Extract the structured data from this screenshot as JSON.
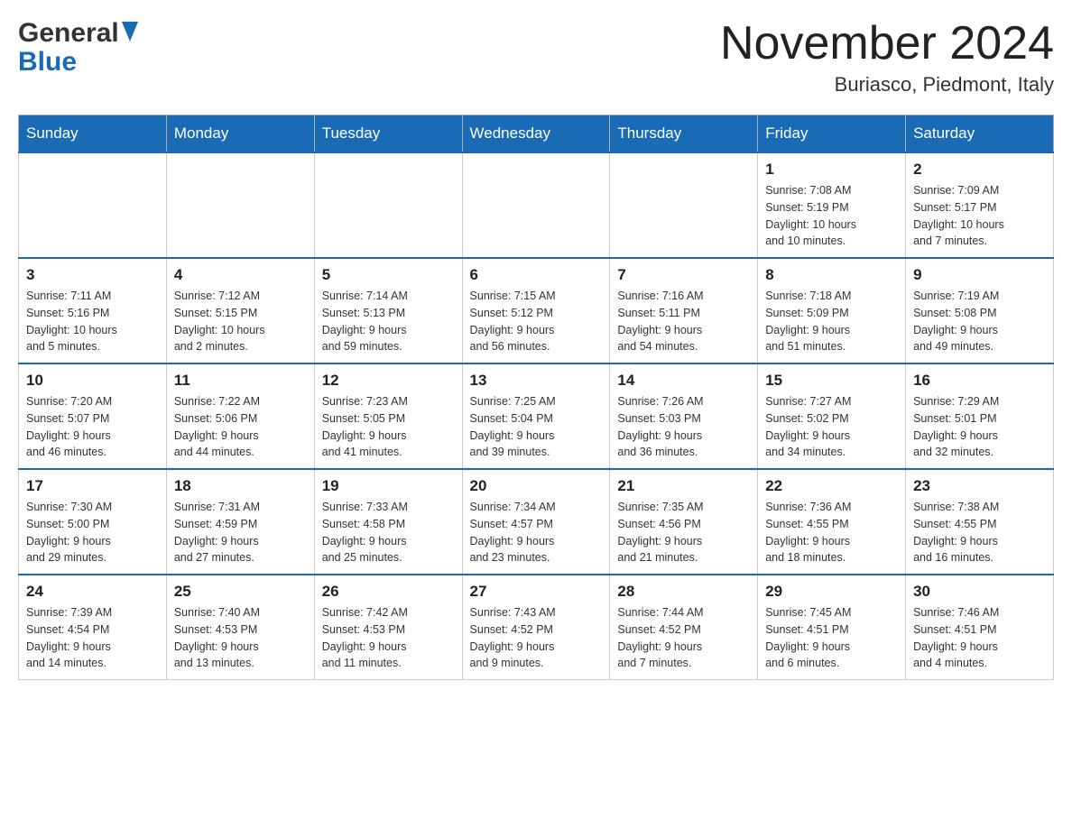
{
  "header": {
    "logo_general": "General",
    "logo_blue": "Blue",
    "month_title": "November 2024",
    "location": "Buriasco, Piedmont, Italy"
  },
  "days_of_week": [
    "Sunday",
    "Monday",
    "Tuesday",
    "Wednesday",
    "Thursday",
    "Friday",
    "Saturday"
  ],
  "weeks": [
    [
      {
        "day": "",
        "info": ""
      },
      {
        "day": "",
        "info": ""
      },
      {
        "day": "",
        "info": ""
      },
      {
        "day": "",
        "info": ""
      },
      {
        "day": "",
        "info": ""
      },
      {
        "day": "1",
        "info": "Sunrise: 7:08 AM\nSunset: 5:19 PM\nDaylight: 10 hours\nand 10 minutes."
      },
      {
        "day": "2",
        "info": "Sunrise: 7:09 AM\nSunset: 5:17 PM\nDaylight: 10 hours\nand 7 minutes."
      }
    ],
    [
      {
        "day": "3",
        "info": "Sunrise: 7:11 AM\nSunset: 5:16 PM\nDaylight: 10 hours\nand 5 minutes."
      },
      {
        "day": "4",
        "info": "Sunrise: 7:12 AM\nSunset: 5:15 PM\nDaylight: 10 hours\nand 2 minutes."
      },
      {
        "day": "5",
        "info": "Sunrise: 7:14 AM\nSunset: 5:13 PM\nDaylight: 9 hours\nand 59 minutes."
      },
      {
        "day": "6",
        "info": "Sunrise: 7:15 AM\nSunset: 5:12 PM\nDaylight: 9 hours\nand 56 minutes."
      },
      {
        "day": "7",
        "info": "Sunrise: 7:16 AM\nSunset: 5:11 PM\nDaylight: 9 hours\nand 54 minutes."
      },
      {
        "day": "8",
        "info": "Sunrise: 7:18 AM\nSunset: 5:09 PM\nDaylight: 9 hours\nand 51 minutes."
      },
      {
        "day": "9",
        "info": "Sunrise: 7:19 AM\nSunset: 5:08 PM\nDaylight: 9 hours\nand 49 minutes."
      }
    ],
    [
      {
        "day": "10",
        "info": "Sunrise: 7:20 AM\nSunset: 5:07 PM\nDaylight: 9 hours\nand 46 minutes."
      },
      {
        "day": "11",
        "info": "Sunrise: 7:22 AM\nSunset: 5:06 PM\nDaylight: 9 hours\nand 44 minutes."
      },
      {
        "day": "12",
        "info": "Sunrise: 7:23 AM\nSunset: 5:05 PM\nDaylight: 9 hours\nand 41 minutes."
      },
      {
        "day": "13",
        "info": "Sunrise: 7:25 AM\nSunset: 5:04 PM\nDaylight: 9 hours\nand 39 minutes."
      },
      {
        "day": "14",
        "info": "Sunrise: 7:26 AM\nSunset: 5:03 PM\nDaylight: 9 hours\nand 36 minutes."
      },
      {
        "day": "15",
        "info": "Sunrise: 7:27 AM\nSunset: 5:02 PM\nDaylight: 9 hours\nand 34 minutes."
      },
      {
        "day": "16",
        "info": "Sunrise: 7:29 AM\nSunset: 5:01 PM\nDaylight: 9 hours\nand 32 minutes."
      }
    ],
    [
      {
        "day": "17",
        "info": "Sunrise: 7:30 AM\nSunset: 5:00 PM\nDaylight: 9 hours\nand 29 minutes."
      },
      {
        "day": "18",
        "info": "Sunrise: 7:31 AM\nSunset: 4:59 PM\nDaylight: 9 hours\nand 27 minutes."
      },
      {
        "day": "19",
        "info": "Sunrise: 7:33 AM\nSunset: 4:58 PM\nDaylight: 9 hours\nand 25 minutes."
      },
      {
        "day": "20",
        "info": "Sunrise: 7:34 AM\nSunset: 4:57 PM\nDaylight: 9 hours\nand 23 minutes."
      },
      {
        "day": "21",
        "info": "Sunrise: 7:35 AM\nSunset: 4:56 PM\nDaylight: 9 hours\nand 21 minutes."
      },
      {
        "day": "22",
        "info": "Sunrise: 7:36 AM\nSunset: 4:55 PM\nDaylight: 9 hours\nand 18 minutes."
      },
      {
        "day": "23",
        "info": "Sunrise: 7:38 AM\nSunset: 4:55 PM\nDaylight: 9 hours\nand 16 minutes."
      }
    ],
    [
      {
        "day": "24",
        "info": "Sunrise: 7:39 AM\nSunset: 4:54 PM\nDaylight: 9 hours\nand 14 minutes."
      },
      {
        "day": "25",
        "info": "Sunrise: 7:40 AM\nSunset: 4:53 PM\nDaylight: 9 hours\nand 13 minutes."
      },
      {
        "day": "26",
        "info": "Sunrise: 7:42 AM\nSunset: 4:53 PM\nDaylight: 9 hours\nand 11 minutes."
      },
      {
        "day": "27",
        "info": "Sunrise: 7:43 AM\nSunset: 4:52 PM\nDaylight: 9 hours\nand 9 minutes."
      },
      {
        "day": "28",
        "info": "Sunrise: 7:44 AM\nSunset: 4:52 PM\nDaylight: 9 hours\nand 7 minutes."
      },
      {
        "day": "29",
        "info": "Sunrise: 7:45 AM\nSunset: 4:51 PM\nDaylight: 9 hours\nand 6 minutes."
      },
      {
        "day": "30",
        "info": "Sunrise: 7:46 AM\nSunset: 4:51 PM\nDaylight: 9 hours\nand 4 minutes."
      }
    ]
  ]
}
